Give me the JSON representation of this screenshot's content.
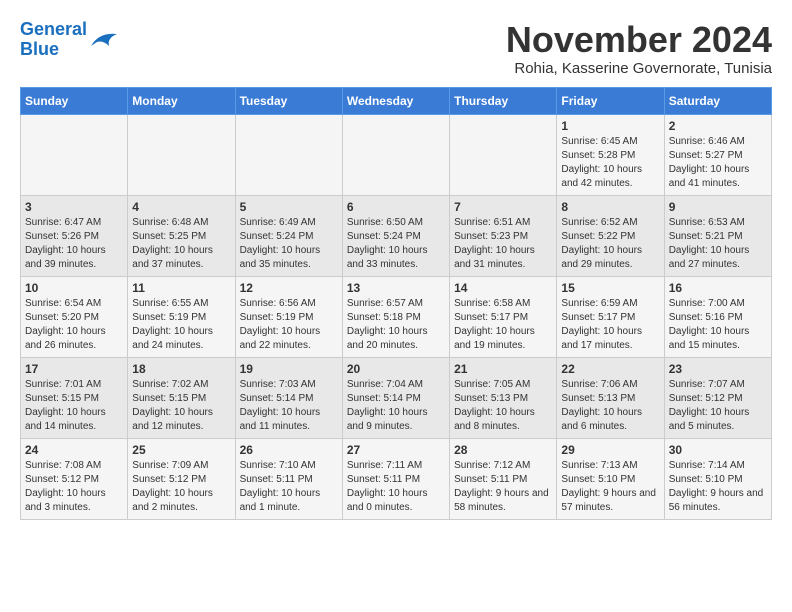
{
  "header": {
    "logo_line1": "General",
    "logo_line2": "Blue",
    "month": "November 2024",
    "location": "Rohia, Kasserine Governorate, Tunisia"
  },
  "days_of_week": [
    "Sunday",
    "Monday",
    "Tuesday",
    "Wednesday",
    "Thursday",
    "Friday",
    "Saturday"
  ],
  "weeks": [
    [
      {
        "num": "",
        "info": ""
      },
      {
        "num": "",
        "info": ""
      },
      {
        "num": "",
        "info": ""
      },
      {
        "num": "",
        "info": ""
      },
      {
        "num": "",
        "info": ""
      },
      {
        "num": "1",
        "info": "Sunrise: 6:45 AM\nSunset: 5:28 PM\nDaylight: 10 hours and 42 minutes."
      },
      {
        "num": "2",
        "info": "Sunrise: 6:46 AM\nSunset: 5:27 PM\nDaylight: 10 hours and 41 minutes."
      }
    ],
    [
      {
        "num": "3",
        "info": "Sunrise: 6:47 AM\nSunset: 5:26 PM\nDaylight: 10 hours and 39 minutes."
      },
      {
        "num": "4",
        "info": "Sunrise: 6:48 AM\nSunset: 5:25 PM\nDaylight: 10 hours and 37 minutes."
      },
      {
        "num": "5",
        "info": "Sunrise: 6:49 AM\nSunset: 5:24 PM\nDaylight: 10 hours and 35 minutes."
      },
      {
        "num": "6",
        "info": "Sunrise: 6:50 AM\nSunset: 5:24 PM\nDaylight: 10 hours and 33 minutes."
      },
      {
        "num": "7",
        "info": "Sunrise: 6:51 AM\nSunset: 5:23 PM\nDaylight: 10 hours and 31 minutes."
      },
      {
        "num": "8",
        "info": "Sunrise: 6:52 AM\nSunset: 5:22 PM\nDaylight: 10 hours and 29 minutes."
      },
      {
        "num": "9",
        "info": "Sunrise: 6:53 AM\nSunset: 5:21 PM\nDaylight: 10 hours and 27 minutes."
      }
    ],
    [
      {
        "num": "10",
        "info": "Sunrise: 6:54 AM\nSunset: 5:20 PM\nDaylight: 10 hours and 26 minutes."
      },
      {
        "num": "11",
        "info": "Sunrise: 6:55 AM\nSunset: 5:19 PM\nDaylight: 10 hours and 24 minutes."
      },
      {
        "num": "12",
        "info": "Sunrise: 6:56 AM\nSunset: 5:19 PM\nDaylight: 10 hours and 22 minutes."
      },
      {
        "num": "13",
        "info": "Sunrise: 6:57 AM\nSunset: 5:18 PM\nDaylight: 10 hours and 20 minutes."
      },
      {
        "num": "14",
        "info": "Sunrise: 6:58 AM\nSunset: 5:17 PM\nDaylight: 10 hours and 19 minutes."
      },
      {
        "num": "15",
        "info": "Sunrise: 6:59 AM\nSunset: 5:17 PM\nDaylight: 10 hours and 17 minutes."
      },
      {
        "num": "16",
        "info": "Sunrise: 7:00 AM\nSunset: 5:16 PM\nDaylight: 10 hours and 15 minutes."
      }
    ],
    [
      {
        "num": "17",
        "info": "Sunrise: 7:01 AM\nSunset: 5:15 PM\nDaylight: 10 hours and 14 minutes."
      },
      {
        "num": "18",
        "info": "Sunrise: 7:02 AM\nSunset: 5:15 PM\nDaylight: 10 hours and 12 minutes."
      },
      {
        "num": "19",
        "info": "Sunrise: 7:03 AM\nSunset: 5:14 PM\nDaylight: 10 hours and 11 minutes."
      },
      {
        "num": "20",
        "info": "Sunrise: 7:04 AM\nSunset: 5:14 PM\nDaylight: 10 hours and 9 minutes."
      },
      {
        "num": "21",
        "info": "Sunrise: 7:05 AM\nSunset: 5:13 PM\nDaylight: 10 hours and 8 minutes."
      },
      {
        "num": "22",
        "info": "Sunrise: 7:06 AM\nSunset: 5:13 PM\nDaylight: 10 hours and 6 minutes."
      },
      {
        "num": "23",
        "info": "Sunrise: 7:07 AM\nSunset: 5:12 PM\nDaylight: 10 hours and 5 minutes."
      }
    ],
    [
      {
        "num": "24",
        "info": "Sunrise: 7:08 AM\nSunset: 5:12 PM\nDaylight: 10 hours and 3 minutes."
      },
      {
        "num": "25",
        "info": "Sunrise: 7:09 AM\nSunset: 5:12 PM\nDaylight: 10 hours and 2 minutes."
      },
      {
        "num": "26",
        "info": "Sunrise: 7:10 AM\nSunset: 5:11 PM\nDaylight: 10 hours and 1 minute."
      },
      {
        "num": "27",
        "info": "Sunrise: 7:11 AM\nSunset: 5:11 PM\nDaylight: 10 hours and 0 minutes."
      },
      {
        "num": "28",
        "info": "Sunrise: 7:12 AM\nSunset: 5:11 PM\nDaylight: 9 hours and 58 minutes."
      },
      {
        "num": "29",
        "info": "Sunrise: 7:13 AM\nSunset: 5:10 PM\nDaylight: 9 hours and 57 minutes."
      },
      {
        "num": "30",
        "info": "Sunrise: 7:14 AM\nSunset: 5:10 PM\nDaylight: 9 hours and 56 minutes."
      }
    ]
  ]
}
